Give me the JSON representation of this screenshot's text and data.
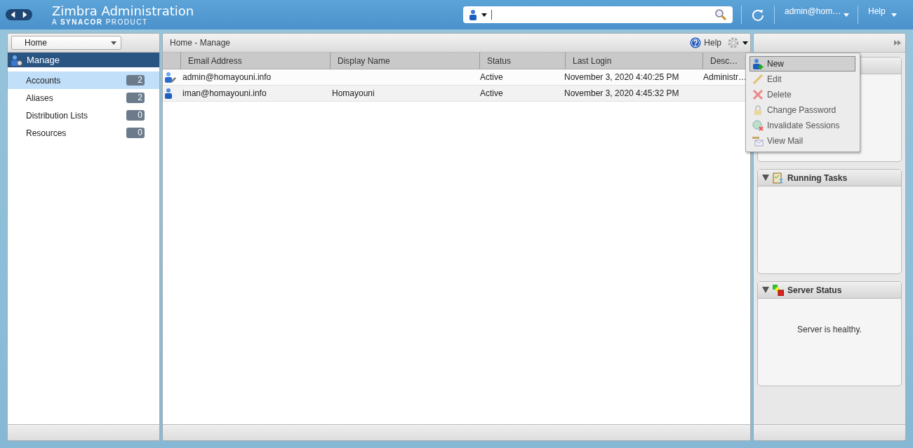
{
  "header": {
    "title": "Zimbra Administration",
    "subtitle_prefix": "A",
    "subtitle_brand": "SYNACOR",
    "subtitle_suffix": "PRODUCT",
    "user": "admin@hom…",
    "help": "Help"
  },
  "sidebar": {
    "breadcrumb": "Home",
    "section": "Manage",
    "items": [
      {
        "label": "Accounts",
        "count": "2",
        "selected": true
      },
      {
        "label": "Aliases",
        "count": "2",
        "selected": false
      },
      {
        "label": "Distribution Lists",
        "count": "0",
        "selected": false
      },
      {
        "label": "Resources",
        "count": "0",
        "selected": false
      }
    ]
  },
  "content": {
    "title": "Home - Manage",
    "help": "Help",
    "table": {
      "columns": [
        "Email Address",
        "Display Name",
        "Status",
        "Last Login",
        "Desc…"
      ],
      "rows": [
        {
          "kind": "admin",
          "cells": [
            "admin@homayouni.info",
            "",
            "Active",
            "November 3, 2020 4:40:25 PM",
            "Administr…"
          ]
        },
        {
          "kind": "user",
          "cells": [
            "iman@homayouni.info",
            "Homayouni",
            "Active",
            "November 3, 2020 4:45:32 PM",
            ""
          ]
        }
      ]
    }
  },
  "menu": [
    {
      "label": "New",
      "kind": "new",
      "selected": true
    },
    {
      "label": "Edit",
      "kind": "edit",
      "selected": false
    },
    {
      "label": "Delete",
      "kind": "delete",
      "selected": false
    },
    {
      "label": "Change Password",
      "kind": "lock",
      "selected": false
    },
    {
      "label": "Invalidate Sessions",
      "kind": "globe",
      "selected": false
    },
    {
      "label": "View Mail",
      "kind": "mail",
      "selected": false
    }
  ],
  "portlets": [
    {
      "kind": "hidden"
    },
    {
      "title": "Running Tasks",
      "kind": "tasks"
    },
    {
      "title": "Server Status",
      "kind": "status",
      "text": "Server is healthy."
    }
  ]
}
